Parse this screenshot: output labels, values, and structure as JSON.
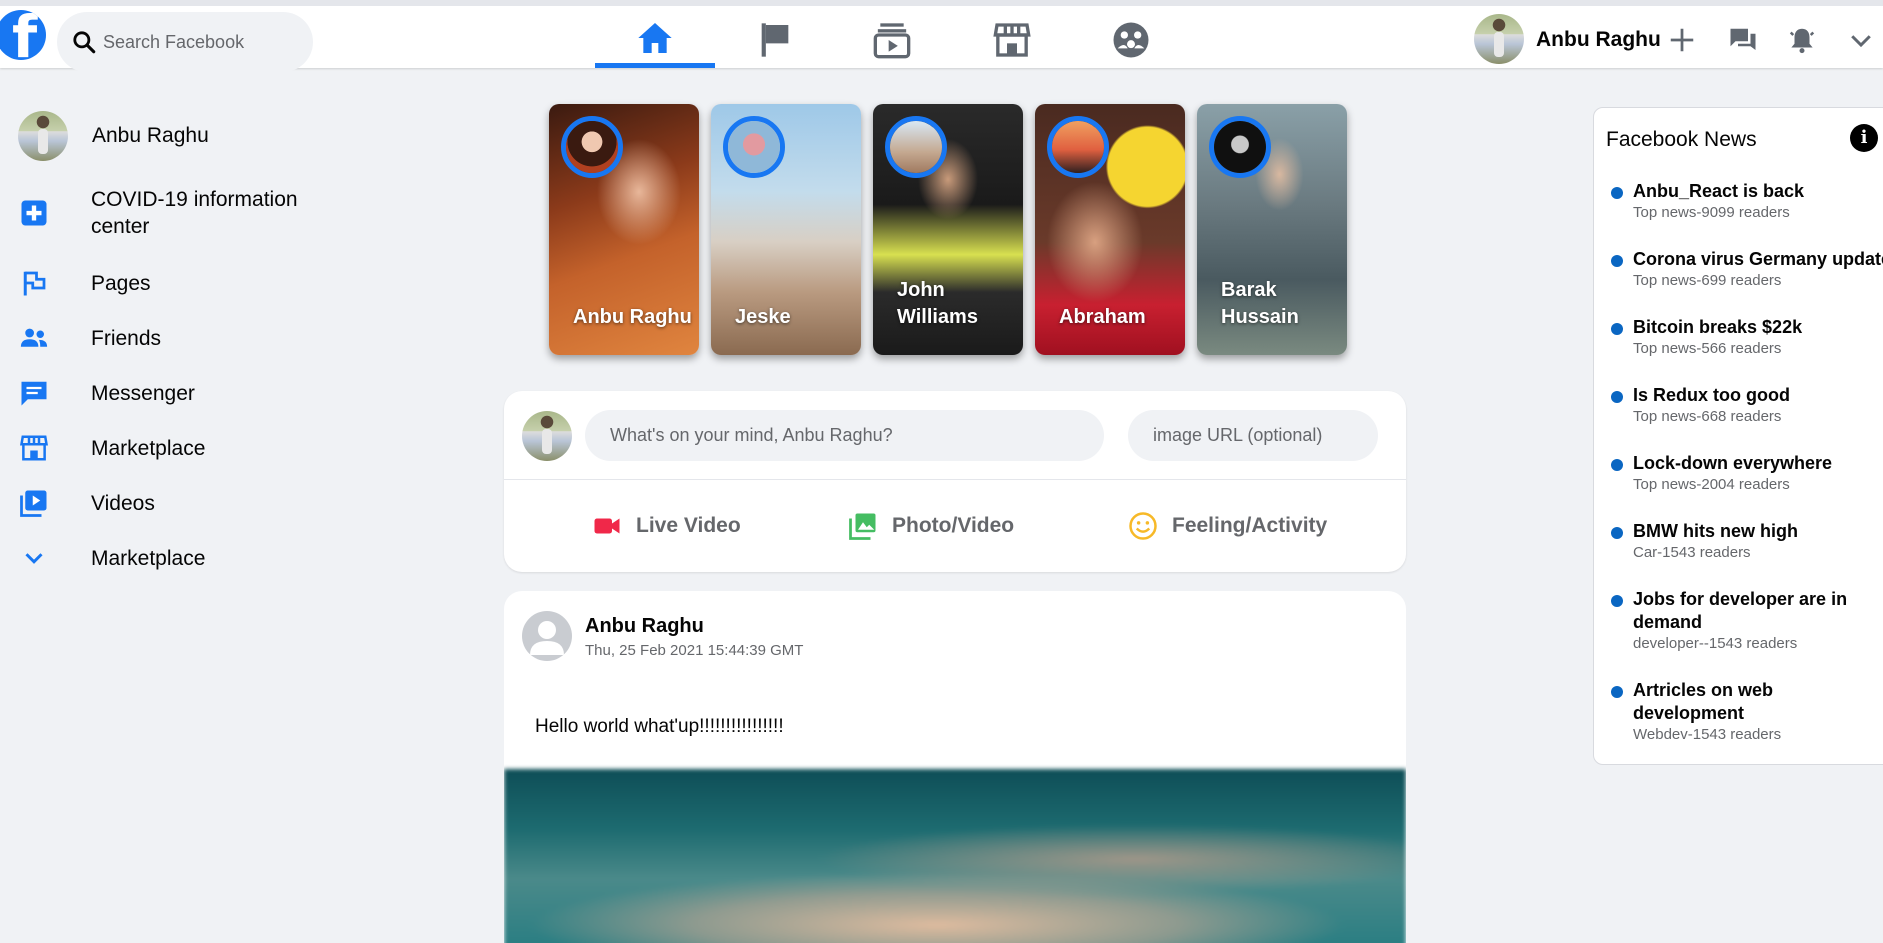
{
  "header": {
    "search_placeholder": "Search Facebook",
    "user_name": "Anbu Raghu",
    "nav": [
      "home-icon",
      "flag-icon",
      "watch-icon",
      "marketplace-icon",
      "groups-icon"
    ]
  },
  "sidebar": {
    "profile_name": "Anbu Raghu",
    "items": [
      {
        "label": "COVID-19 information center",
        "icon": "covid-icon"
      },
      {
        "label": "Pages",
        "icon": "pages-flag-icon"
      },
      {
        "label": "Friends",
        "icon": "friends-icon"
      },
      {
        "label": "Messenger",
        "icon": "messenger-icon"
      },
      {
        "label": "Marketplace",
        "icon": "marketplace-icon"
      },
      {
        "label": "Videos",
        "icon": "videos-icon"
      },
      {
        "label": "Marketplace",
        "icon": "chevron-down-icon"
      }
    ]
  },
  "stories": [
    {
      "name": "Anbu Raghu"
    },
    {
      "name": "Jeske"
    },
    {
      "name": "John Williams"
    },
    {
      "name": "Abraham"
    },
    {
      "name": "Barak Hussain"
    }
  ],
  "composer": {
    "status_placeholder": "What's on your mind, Anbu Raghu?",
    "url_placeholder": "image URL (optional)",
    "live_label": "Live Video",
    "photo_label": "Photo/Video",
    "feeling_label": "Feeling/Activity"
  },
  "post": {
    "author": "Anbu Raghu",
    "timestamp": "Thu, 25 Feb 2021 15:44:39 GMT",
    "text": "Hello world what'up!!!!!!!!!!!!!!!!"
  },
  "news": {
    "title": "Facebook News",
    "info_glyph": "i",
    "items": [
      {
        "headline": "Anbu_React is back",
        "sub": "Top news-9099 readers"
      },
      {
        "headline": "Corona virus Germany update",
        "sub": "Top news-699 readers"
      },
      {
        "headline": "Bitcoin breaks $22k",
        "sub": "Top news-566 readers"
      },
      {
        "headline": "Is Redux too good",
        "sub": "Top news-668 readers"
      },
      {
        "headline": "Lock-down everywhere",
        "sub": "Top news-2004 readers"
      },
      {
        "headline": "BMW hits new high",
        "sub": "Car-1543 readers"
      },
      {
        "headline": "Jobs for developer are in demand",
        "sub": "developer--1543 readers"
      },
      {
        "headline": "Artricles on web development",
        "sub": "Webdev-1543 readers"
      }
    ]
  },
  "colors": {
    "accent": "#1877f2",
    "background": "#f0f2f5",
    "live_red": "#f02849",
    "photo_green": "#45bd62",
    "feeling_yellow": "#f7b928",
    "news_dot": "#0a66c2"
  }
}
